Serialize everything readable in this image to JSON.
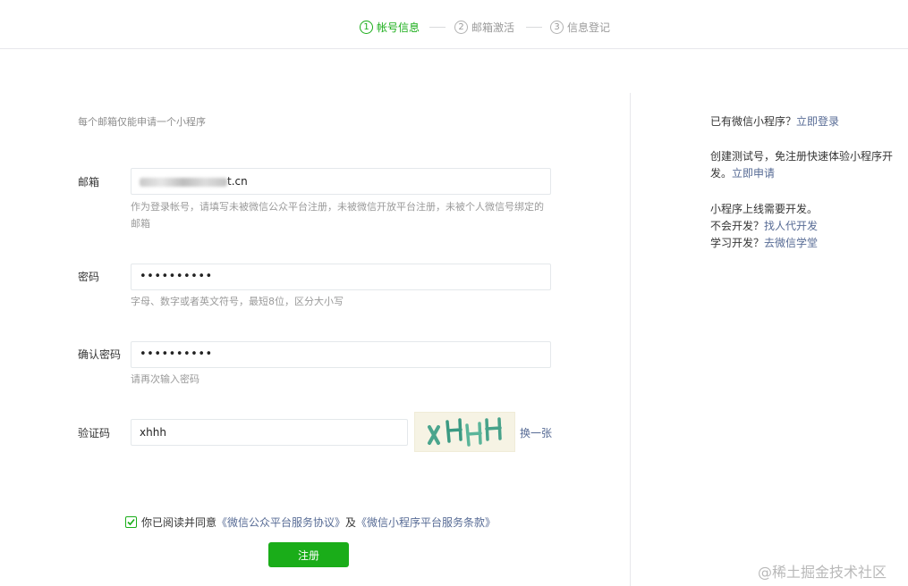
{
  "stepper": {
    "steps": [
      {
        "num": "1",
        "label": "帐号信息",
        "active": true
      },
      {
        "num": "2",
        "label": "邮箱激活",
        "active": false
      },
      {
        "num": "3",
        "label": "信息登记",
        "active": false
      }
    ]
  },
  "form": {
    "tip": "每个邮箱仅能申请一个小程序",
    "email": {
      "label": "邮箱",
      "value": "t.cn",
      "hint": "作为登录帐号，请填写未被微信公众平台注册，未被微信开放平台注册，未被个人微信号绑定的邮箱"
    },
    "password": {
      "label": "密码",
      "value": "••••••••••",
      "hint": "字母、数字或者英文符号，最短8位，区分大小写"
    },
    "confirm": {
      "label": "确认密码",
      "value": "••••••••••",
      "hint": "请再次输入密码"
    },
    "captcha": {
      "label": "验证码",
      "value": "xhhh",
      "image_text": "XHHH",
      "refresh_label": "换一张"
    },
    "agreement": {
      "checked": true,
      "prefix": "你已阅读并同意",
      "link1": "《微信公众平台服务协议》",
      "middle": "及",
      "link2": "《微信小程序平台服务条款》"
    },
    "submit_label": "注册"
  },
  "side": {
    "login": {
      "text": "已有微信小程序？",
      "link": "立即登录"
    },
    "test": {
      "text": "创建测试号，免注册快速体验小程序开发。",
      "link": "立即申请"
    },
    "dev": {
      "line1": "小程序上线需要开发。",
      "line2_text": "不会开发？",
      "line2_link": "找人代开发",
      "line3_text": "学习开发？",
      "line3_link": "去微信学堂"
    }
  },
  "watermark": "@稀土掘金技术社区",
  "colors": {
    "accent": "#1aad19",
    "link": "#576b95",
    "border": "#e4e8eb"
  }
}
